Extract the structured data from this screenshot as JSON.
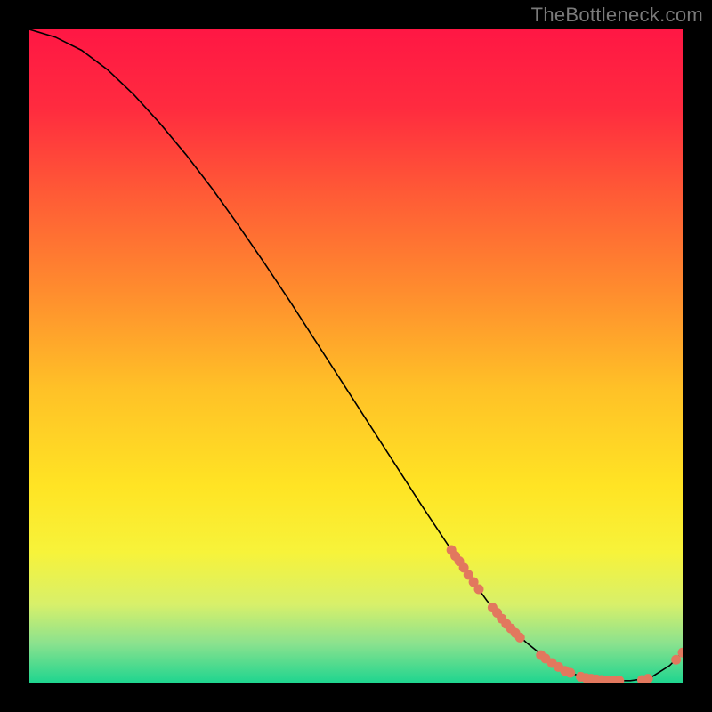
{
  "attribution": "TheBottleneck.com",
  "chart_data": {
    "type": "line",
    "title": "",
    "xlabel": "",
    "ylabel": "",
    "xlim": [
      0,
      100
    ],
    "ylim": [
      0,
      100
    ],
    "grid": false,
    "background_gradient": [
      {
        "offset": 0,
        "color": "#ff1744"
      },
      {
        "offset": 12,
        "color": "#ff2b3f"
      },
      {
        "offset": 25,
        "color": "#ff5a36"
      },
      {
        "offset": 40,
        "color": "#ff8c2e"
      },
      {
        "offset": 55,
        "color": "#ffc127"
      },
      {
        "offset": 70,
        "color": "#ffe424"
      },
      {
        "offset": 80,
        "color": "#f7f33a"
      },
      {
        "offset": 88,
        "color": "#d8f06a"
      },
      {
        "offset": 94,
        "color": "#8be28e"
      },
      {
        "offset": 100,
        "color": "#1fd58f"
      }
    ],
    "curve": {
      "name": "bottleneck-curve",
      "color": "#000000",
      "x": [
        0,
        4,
        8,
        12,
        16,
        20,
        24,
        28,
        32,
        36,
        40,
        44,
        48,
        52,
        56,
        60,
        64,
        68,
        70,
        73,
        76,
        80,
        83,
        86,
        89,
        92,
        95,
        98,
        100
      ],
      "y": [
        100,
        98.8,
        96.8,
        93.8,
        90,
        85.6,
        80.8,
        75.6,
        70,
        64.2,
        58.2,
        52,
        45.8,
        39.6,
        33.4,
        27.2,
        21.2,
        15.4,
        12.6,
        9,
        6.2,
        3,
        1.4,
        0.6,
        0.3,
        0.3,
        0.7,
        2.6,
        4.6
      ]
    },
    "highlight_points": {
      "name": "highlighted-range",
      "color": "#e2785e",
      "points": [
        {
          "x": 64.6,
          "y": 20.3
        },
        {
          "x": 65.2,
          "y": 19.4
        },
        {
          "x": 65.8,
          "y": 18.6
        },
        {
          "x": 66.5,
          "y": 17.6
        },
        {
          "x": 67.2,
          "y": 16.5
        },
        {
          "x": 68.0,
          "y": 15.4
        },
        {
          "x": 68.8,
          "y": 14.3
        },
        {
          "x": 70.9,
          "y": 11.5
        },
        {
          "x": 71.6,
          "y": 10.7
        },
        {
          "x": 72.3,
          "y": 9.8
        },
        {
          "x": 73.0,
          "y": 9.0
        },
        {
          "x": 73.7,
          "y": 8.3
        },
        {
          "x": 74.4,
          "y": 7.6
        },
        {
          "x": 75.1,
          "y": 6.9
        },
        {
          "x": 78.3,
          "y": 4.2
        },
        {
          "x": 79.0,
          "y": 3.7
        },
        {
          "x": 80.0,
          "y": 3.0
        },
        {
          "x": 81.0,
          "y": 2.4
        },
        {
          "x": 82.0,
          "y": 1.8
        },
        {
          "x": 82.8,
          "y": 1.5
        },
        {
          "x": 84.4,
          "y": 0.9
        },
        {
          "x": 85.2,
          "y": 0.7
        },
        {
          "x": 86.0,
          "y": 0.6
        },
        {
          "x": 86.8,
          "y": 0.5
        },
        {
          "x": 87.6,
          "y": 0.4
        },
        {
          "x": 88.5,
          "y": 0.3
        },
        {
          "x": 89.4,
          "y": 0.3
        },
        {
          "x": 90.3,
          "y": 0.3
        },
        {
          "x": 93.8,
          "y": 0.4
        },
        {
          "x": 94.7,
          "y": 0.6
        },
        {
          "x": 99.0,
          "y": 3.5
        },
        {
          "x": 100.0,
          "y": 4.6
        }
      ]
    }
  }
}
